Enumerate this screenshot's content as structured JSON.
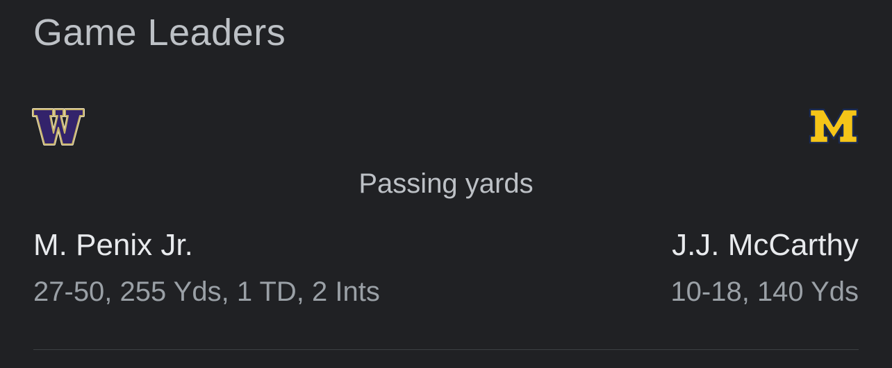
{
  "header": {
    "title": "Game Leaders"
  },
  "teams": {
    "left": {
      "logo_icon": "washington-w-logo-icon",
      "primary_color": "#33236b",
      "accent_color": "#c8b46a"
    },
    "right": {
      "logo_icon": "michigan-m-logo-icon",
      "primary_color": "#f5c518",
      "accent_color": "#1a2a52"
    }
  },
  "leaders": {
    "category": "Passing yards",
    "left": {
      "name": "M. Penix Jr.",
      "stats": "27-50, 255 Yds, 1 TD, 2 Ints"
    },
    "right": {
      "name": "J.J. McCarthy",
      "stats": "10-18, 140 Yds"
    }
  }
}
